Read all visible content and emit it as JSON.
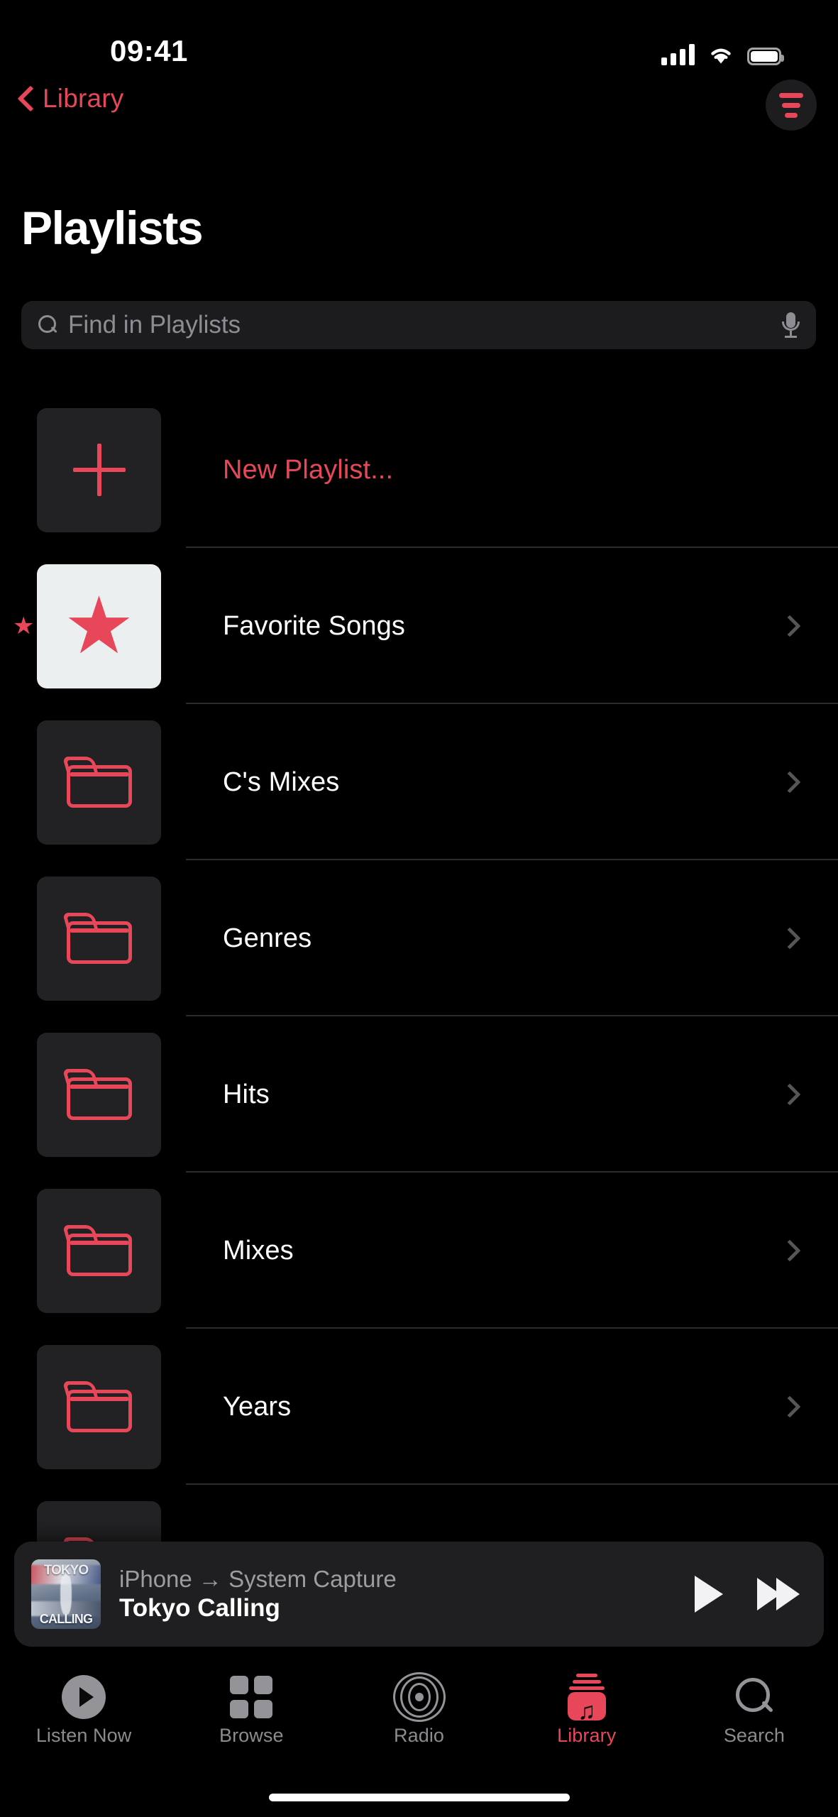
{
  "status_bar": {
    "time": "09:41",
    "cellular_icon": "cellular-signal-icon",
    "wifi_icon": "wifi-icon",
    "battery_icon": "battery-full-icon"
  },
  "nav": {
    "back_label": "Library",
    "back_icon": "chevron-left-icon",
    "sort_button_icon": "sort-filter-icon"
  },
  "header": {
    "title": "Playlists"
  },
  "search": {
    "placeholder": "Find in Playlists",
    "value": "",
    "search_icon": "search-icon",
    "mic_icon": "microphone-icon"
  },
  "list": {
    "rows": [
      {
        "label": "New Playlist...",
        "icon": "plus-icon",
        "style": "accent",
        "thumb": "dark",
        "chevron": false,
        "favorite_marker": false
      },
      {
        "label": "Favorite Songs",
        "icon": "star-icon",
        "style": "default",
        "thumb": "light",
        "chevron": true,
        "favorite_marker": true,
        "marker_glyph": "★"
      },
      {
        "label": "C's Mixes",
        "icon": "folder-icon",
        "style": "default",
        "thumb": "dark",
        "chevron": true,
        "favorite_marker": false
      },
      {
        "label": "Genres",
        "icon": "folder-icon",
        "style": "default",
        "thumb": "dark",
        "chevron": true,
        "favorite_marker": false
      },
      {
        "label": "Hits",
        "icon": "folder-icon",
        "style": "default",
        "thumb": "dark",
        "chevron": true,
        "favorite_marker": false
      },
      {
        "label": "Mixes",
        "icon": "folder-icon",
        "style": "default",
        "thumb": "dark",
        "chevron": true,
        "favorite_marker": false
      },
      {
        "label": "Years",
        "icon": "folder-icon",
        "style": "default",
        "thumb": "dark",
        "chevron": true,
        "favorite_marker": false
      },
      {
        "label": "",
        "icon": "folder-icon",
        "style": "default",
        "thumb": "dark",
        "chevron": false,
        "favorite_marker": false
      }
    ]
  },
  "mini_player": {
    "route": "iPhone → System Capture",
    "track_title": "Tokyo Calling",
    "album_art_top_text": "TOKYO",
    "album_art_bottom_text": "CALLING",
    "play_icon": "play-icon",
    "forward_icon": "fast-forward-icon"
  },
  "tab_bar": {
    "active": "Library",
    "tabs": [
      {
        "label": "Listen Now",
        "icon": "listen-now-icon"
      },
      {
        "label": "Browse",
        "icon": "browse-grid-icon"
      },
      {
        "label": "Radio",
        "icon": "radio-broadcast-icon"
      },
      {
        "label": "Library",
        "icon": "library-icon"
      },
      {
        "label": "Search",
        "icon": "search-icon"
      }
    ]
  },
  "colors": {
    "accent": "#e8475a",
    "background": "#000000",
    "thumb_dark": "#222224",
    "thumb_light": "#eceff0",
    "separator": "#2b2b2d",
    "secondary_text": "#8d8d93",
    "mini_player_bg": "#1f1f21"
  }
}
